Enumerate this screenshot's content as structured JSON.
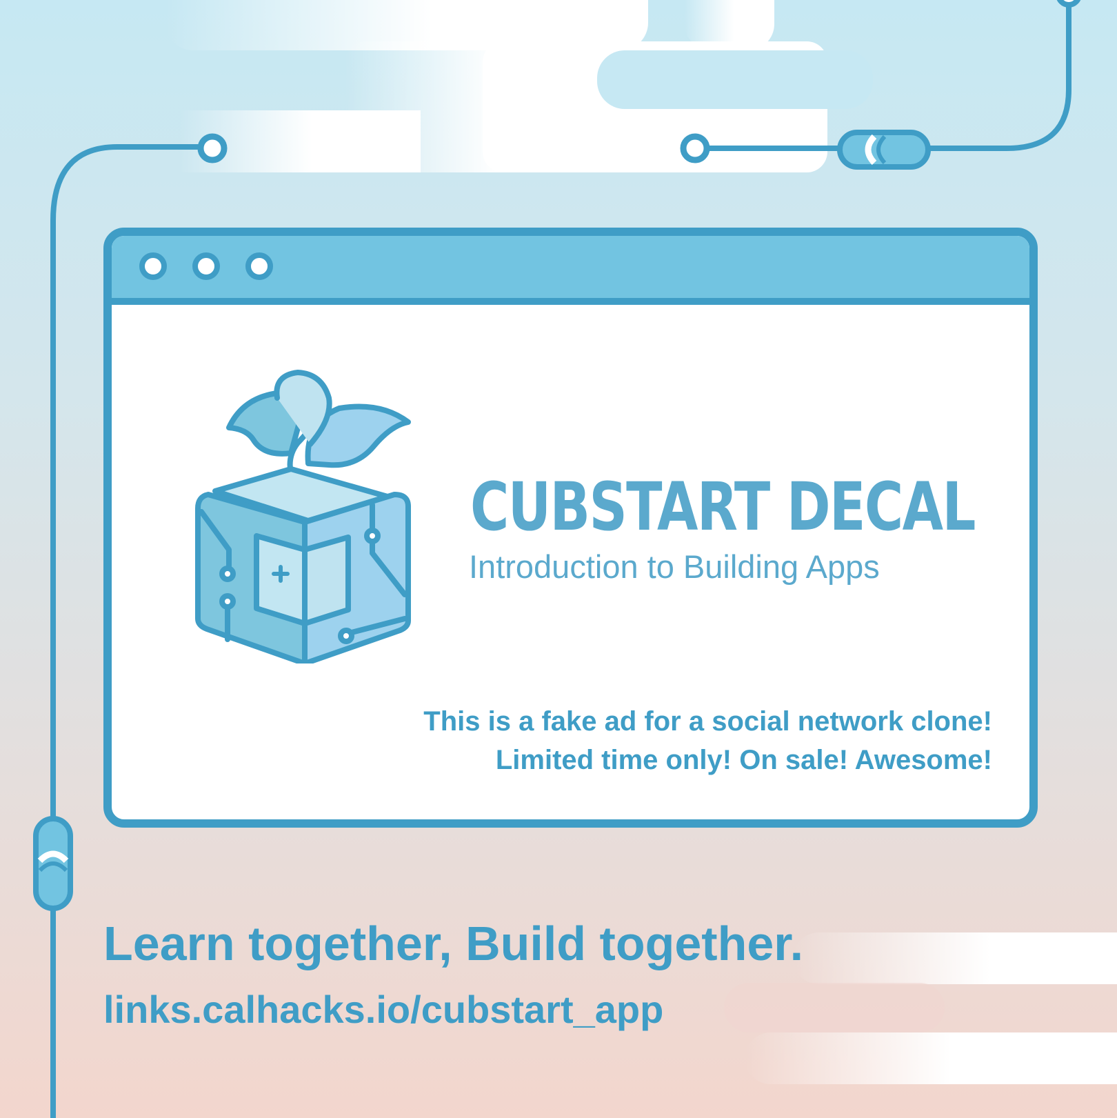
{
  "card": {
    "title": "CUBSTART DECAL",
    "subtitle": "Introduction to Building Apps",
    "ad_lines": [
      "This is a fake ad for a social network clone!",
      "Limited time only! On sale! Awesome!"
    ]
  },
  "footer": {
    "tagline": "Learn together, Build together.",
    "link": "links.calhacks.io/cubstart_app"
  },
  "colors": {
    "primary": "#3f9dc6",
    "titlebar": "#72c4e1",
    "text_light": "#5ba9cd"
  }
}
